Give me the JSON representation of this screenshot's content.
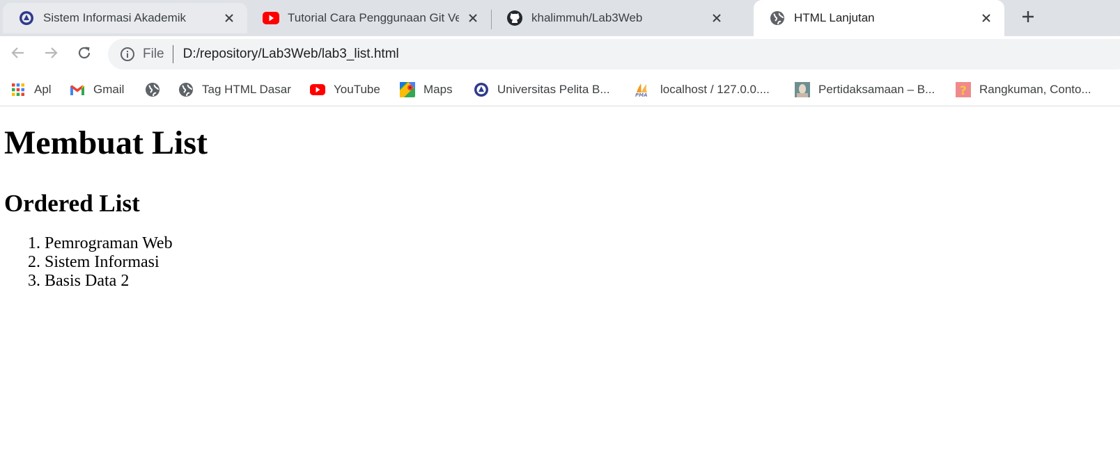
{
  "tabs": [
    {
      "title": "Sistem Informasi Akademik",
      "icon": "university-crest-icon"
    },
    {
      "title": "Tutorial Cara Penggunaan Git Ver",
      "icon": "youtube-icon"
    },
    {
      "title": "khalimmuh/Lab3Web",
      "icon": "github-icon"
    },
    {
      "title": "HTML Lanjutan",
      "icon": "globe-icon",
      "active": true
    }
  ],
  "omnibox": {
    "scheme": "File",
    "url": "D:/repository/Lab3Web/lab3_list.html"
  },
  "bookmarks": [
    {
      "label": "Apl",
      "icon": "apps-grid-icon"
    },
    {
      "label": "Gmail",
      "icon": "gmail-icon"
    },
    {
      "label": "",
      "icon": "globe-icon"
    },
    {
      "label": "Tag HTML Dasar",
      "icon": "globe-icon"
    },
    {
      "label": "YouTube",
      "icon": "youtube-icon"
    },
    {
      "label": "Maps",
      "icon": "maps-icon"
    },
    {
      "label": "Universitas Pelita B...",
      "icon": "university-crest-icon"
    },
    {
      "label": "localhost / 127.0.0....",
      "icon": "phpmyadmin-icon"
    },
    {
      "label": "Pertidaksamaan – B...",
      "icon": "thumbnail-icon"
    },
    {
      "label": "Rangkuman, Conto...",
      "icon": "question-thumbnail-icon"
    }
  ],
  "page": {
    "heading": "Membuat List",
    "subheading": "Ordered List",
    "list": [
      "Pemrograman Web",
      "Sistem Informasi",
      "Basis Data 2"
    ]
  },
  "colors": {
    "tabstrip": "#dee1e6",
    "omnibox": "#f1f3f4",
    "youtube_red": "#ff0000",
    "icon_gray": "#5f6368"
  }
}
